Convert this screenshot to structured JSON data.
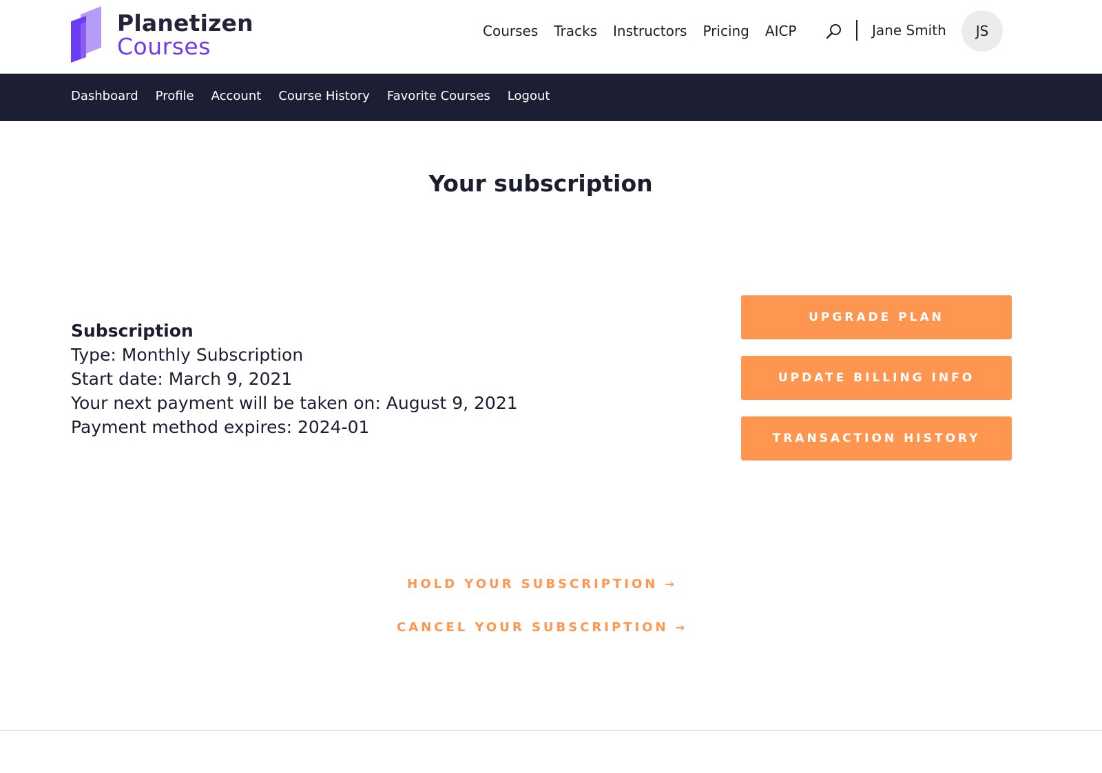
{
  "brand": {
    "name_line1": "Planetizen",
    "name_line2": "Courses",
    "colors": {
      "primary": "#6b3cf2",
      "light": "#b59cf6",
      "mid": "#8b5cf6"
    }
  },
  "header": {
    "nav": [
      "Courses",
      "Tracks",
      "Instructors",
      "Pricing",
      "AICP"
    ],
    "search_icon": "search-icon",
    "user_name": "Jane Smith",
    "avatar_initials": "JS"
  },
  "subnav": {
    "items": [
      "Dashboard",
      "Profile",
      "Account",
      "Course History",
      "Favorite Courses",
      "Logout"
    ],
    "background": "#1c1e33"
  },
  "page": {
    "title": "Your subscription"
  },
  "subscription": {
    "heading": "Subscription",
    "type": "Type: Monthly Subscription",
    "start_date": "Start date: March 9, 2021",
    "next_payment": "Your next payment will be taken on: August 9, 2021",
    "payment_expires": "Payment method expires: 2024-01"
  },
  "actions": {
    "upgrade": "UPGRADE PLAN",
    "billing": "UPDATE BILLING INFO",
    "history": "TRANSACTION HISTORY",
    "color": "#ff9650"
  },
  "links": {
    "hold": "HOLD YOUR SUBSCRIPTION",
    "cancel": "CANCEL YOUR SUBSCRIPTION",
    "arrow_icon": "arrow-right-icon"
  }
}
